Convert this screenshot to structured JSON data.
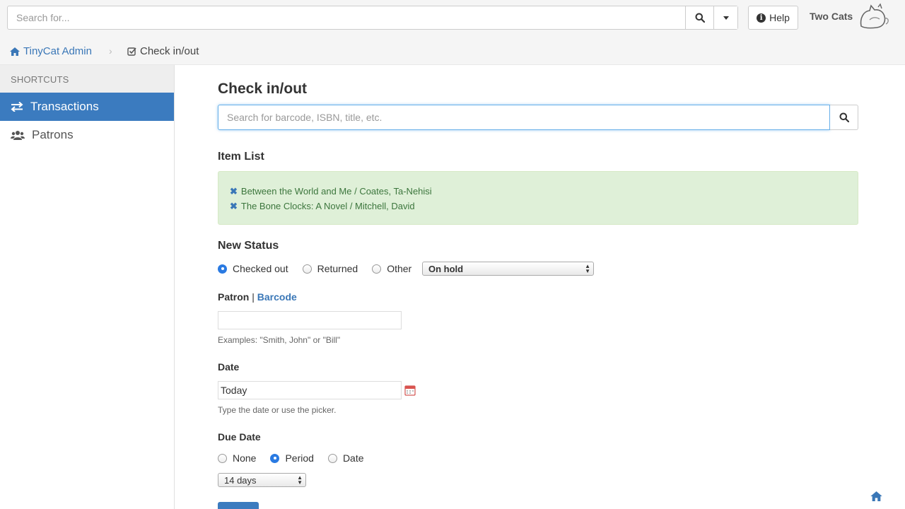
{
  "topbar": {
    "search_placeholder": "Search for...",
    "help_label": "Help",
    "brand": "Two Cats"
  },
  "breadcrumb": {
    "home": "TinyCat Admin",
    "current": "Check in/out"
  },
  "sidebar": {
    "heading": "SHORTCUTS",
    "items": [
      {
        "label": "Transactions",
        "icon": "exchange-icon",
        "active": true
      },
      {
        "label": "Patrons",
        "icon": "users-icon",
        "active": false
      }
    ]
  },
  "main": {
    "title": "Check in/out",
    "search_placeholder": "Search for barcode, ISBN, title, etc.",
    "item_list_heading": "Item List",
    "items": [
      "Between the World and Me / Coates, Ta-Nehisi",
      "The Bone Clocks: A Novel / Mitchell, David"
    ],
    "new_status_heading": "New Status",
    "status_options": [
      "Checked out",
      "Returned",
      "Other"
    ],
    "status_selected": "Checked out",
    "other_select_value": "On hold",
    "patron_label": "Patron",
    "patron_separator": "|",
    "barcode_link": "Barcode",
    "patron_value": "",
    "patron_help": "Examples: \"Smith, John\" or \"Bill\"",
    "date_label": "Date",
    "date_value": "Today",
    "date_help": "Type the date or use the picker.",
    "due_date_label": "Due Date",
    "due_options": [
      "None",
      "Period",
      "Date"
    ],
    "due_selected": "Period",
    "period_value": "14 days"
  },
  "colors": {
    "accent": "#3b7bbf",
    "link": "#3a77b7",
    "success_bg": "#dff0d8",
    "success_text": "#3c763d"
  }
}
